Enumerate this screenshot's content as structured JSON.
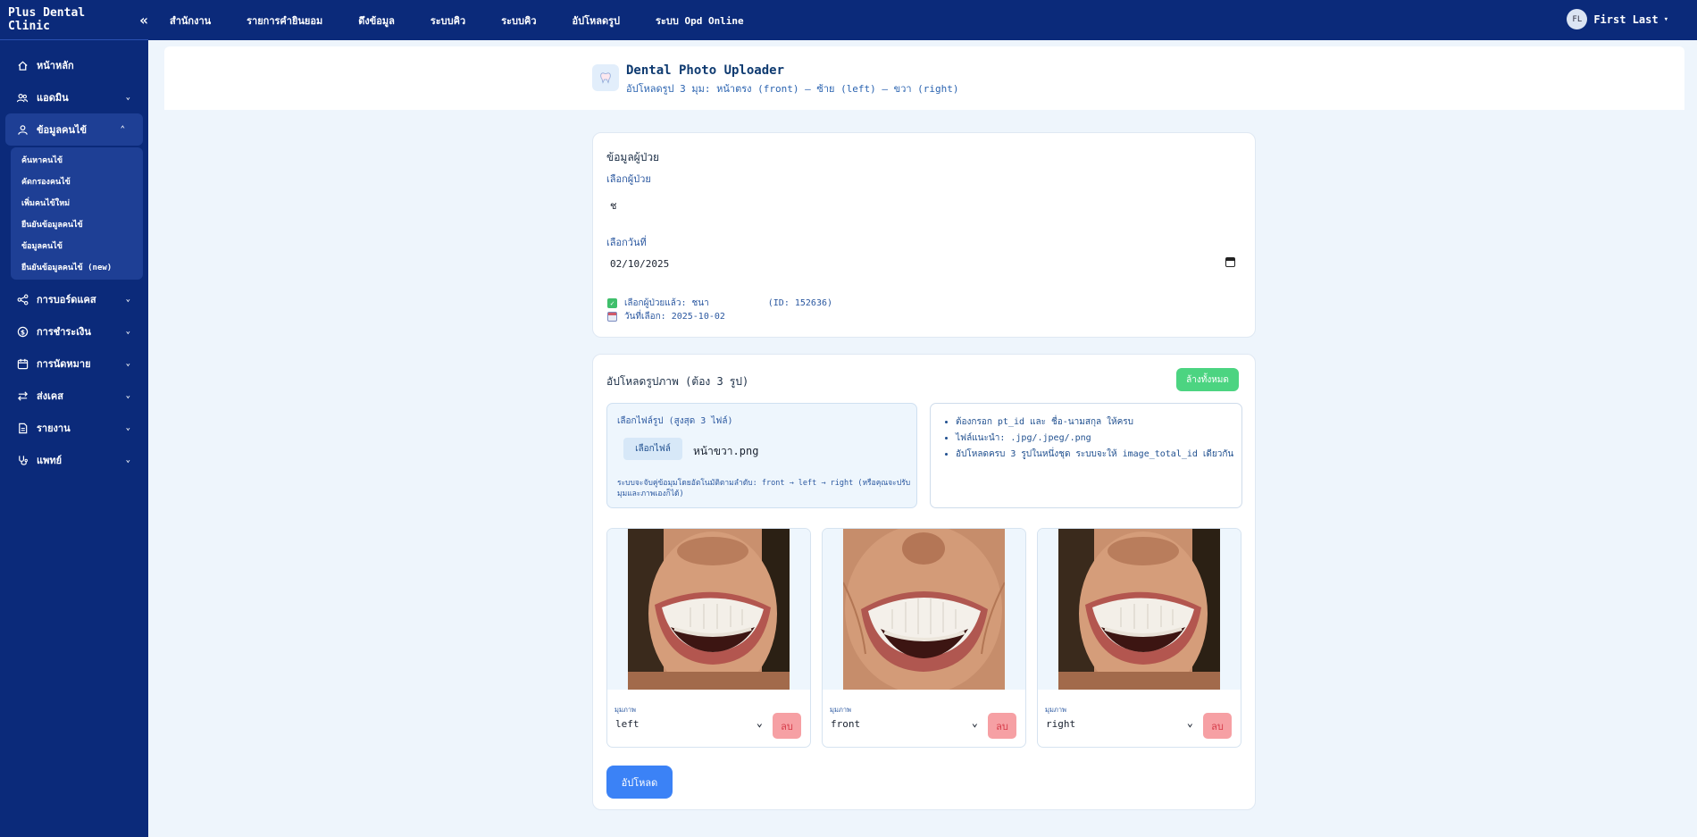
{
  "app": {
    "brand": "Plus Dental Clinic",
    "collapse_icon": "double-chevron-left-icon"
  },
  "topnav": [
    "สำนักงาน",
    "รายการคำยินยอม",
    "ดึงข้อมูล",
    "ระบบคิว",
    "ระบบคิว",
    "อัปโหลดรูป",
    "ระบบ Opd Online"
  ],
  "user": {
    "initials": "FL",
    "name": "First Last"
  },
  "sidebar": {
    "items": [
      {
        "label": "หน้าหลัก",
        "icon": "home-icon"
      },
      {
        "label": "แอดมิน",
        "icon": "users-icon"
      },
      {
        "label": "ข้อมูลคนไข้",
        "icon": "user-icon"
      },
      {
        "label": "การบอร์ดแคส",
        "icon": "share-icon"
      },
      {
        "label": "การชำระเงิน",
        "icon": "dollar-icon"
      },
      {
        "label": "การนัดหมาย",
        "icon": "calendar-icon"
      },
      {
        "label": "ส่งเคส",
        "icon": "transfer-icon"
      },
      {
        "label": "รายงาน",
        "icon": "report-icon"
      },
      {
        "label": "แพทย์",
        "icon": "stethoscope-icon"
      }
    ],
    "sub_items": [
      "ค้นหาคนไข้",
      "คัดกรองคนไข้",
      "เพิ่มคนไข้ใหม่",
      "ยืนยันข้อมูลคนไข้",
      "ข้อมูลคนไข้",
      "ยืนยันข้อมูลคนไข้ (new)"
    ]
  },
  "header": {
    "icon": "tooth-icon",
    "title": "Dental Photo Uploader",
    "subtitle": "อัปโหลดรูป 3 มุม: หน้าตรง (front) – ซ้าย (left) – ขวา (right)"
  },
  "patient_card": {
    "title": "ข้อมูลผู้ป่วย",
    "select_patient_label": "เลือกผู้ป่วย",
    "patient_value": "ช",
    "select_date_label": "เลือกวันที่",
    "date_value": "02/10/2025",
    "selected_patient_text": "เลือกผู้ป่วยแล้ว: ชนา",
    "patient_id_text": "(ID: 152636)",
    "selected_date_text": "วันที่เลือก: 2025-10-02"
  },
  "upload_card": {
    "title": "อัปโหลดรูปภาพ (ต้อง 3 รูป)",
    "clear_label": "ล้างทั้งหมด",
    "file_label": "เลือกไฟล์รูป (สูงสุด 3 ไฟล์)",
    "choose_label": "เลือกไฟล์",
    "file_name": "หน้าขวา.png",
    "hint": "ระบบจะจับคู่ข้อมุมโดยอัตโนมัติตามลำดับ: front → left → right (หรือคุณจะปรับมุมและภาพเองก็ได้)",
    "notes": [
      "ต้องกรอก pt_id และ ชื่อ-นามสกุล ให้ครบ",
      "ไฟล์แนะนำ: .jpg/.jpeg/.png",
      "อัปโหลดครบ 3 รูปในหนึ่งชุด ระบบจะให้ image_total_id เดียวกัน"
    ],
    "angle_label": "มุมภาพ",
    "photos": [
      {
        "angle": "left"
      },
      {
        "angle": "front"
      },
      {
        "angle": "right"
      }
    ],
    "delete_label": "ลบ",
    "upload_label": "อัปโหลด"
  },
  "colors": {
    "navy": "#0b2a7a",
    "accent_green": "#4cd481",
    "primary_blue": "#3b82f6",
    "danger_soft": "#f6a0a4"
  }
}
